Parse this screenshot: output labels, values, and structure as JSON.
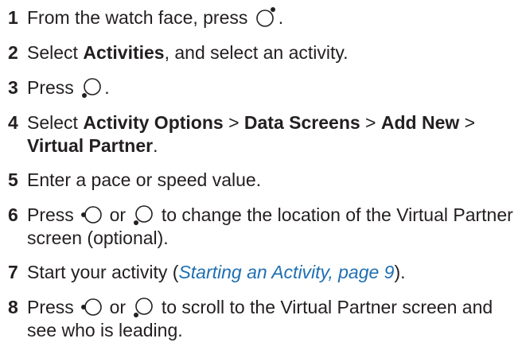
{
  "steps": [
    {
      "num": "1",
      "pre": "From the watch face, press",
      "icon": "watch-button-top-right-icon",
      "post": "."
    },
    {
      "num": "2",
      "pre": "Select ",
      "b1": "Activities",
      "post": ", and select an activity."
    },
    {
      "num": "3",
      "pre": "Press",
      "icon": "watch-button-bottom-left-icon",
      "post": "."
    },
    {
      "num": "4",
      "pre": "Select ",
      "b1": "Activity Options",
      "sep1": " > ",
      "b2": "Data Screens",
      "sep2": " > ",
      "b3": "Add New",
      "sep3": " >",
      "b4": "Virtual Partner",
      "post": "."
    },
    {
      "num": "5",
      "text": "Enter a pace or speed value."
    },
    {
      "num": "6",
      "pre": "Press",
      "icon1": "watch-button-left-icon",
      "mid": "or",
      "icon2": "watch-button-bottom-left-icon",
      "post": "to change the location of the Virtual Partner screen (optional)."
    },
    {
      "num": "7",
      "pre": "Start your activity (",
      "link": "Starting an Activity, page 9",
      "post": ")."
    },
    {
      "num": "8",
      "pre": "Press",
      "icon1": "watch-button-left-icon",
      "mid": "or",
      "icon2": "watch-button-bottom-left-icon",
      "post": "to scroll to the Virtual Partner screen and see who is leading."
    }
  ]
}
